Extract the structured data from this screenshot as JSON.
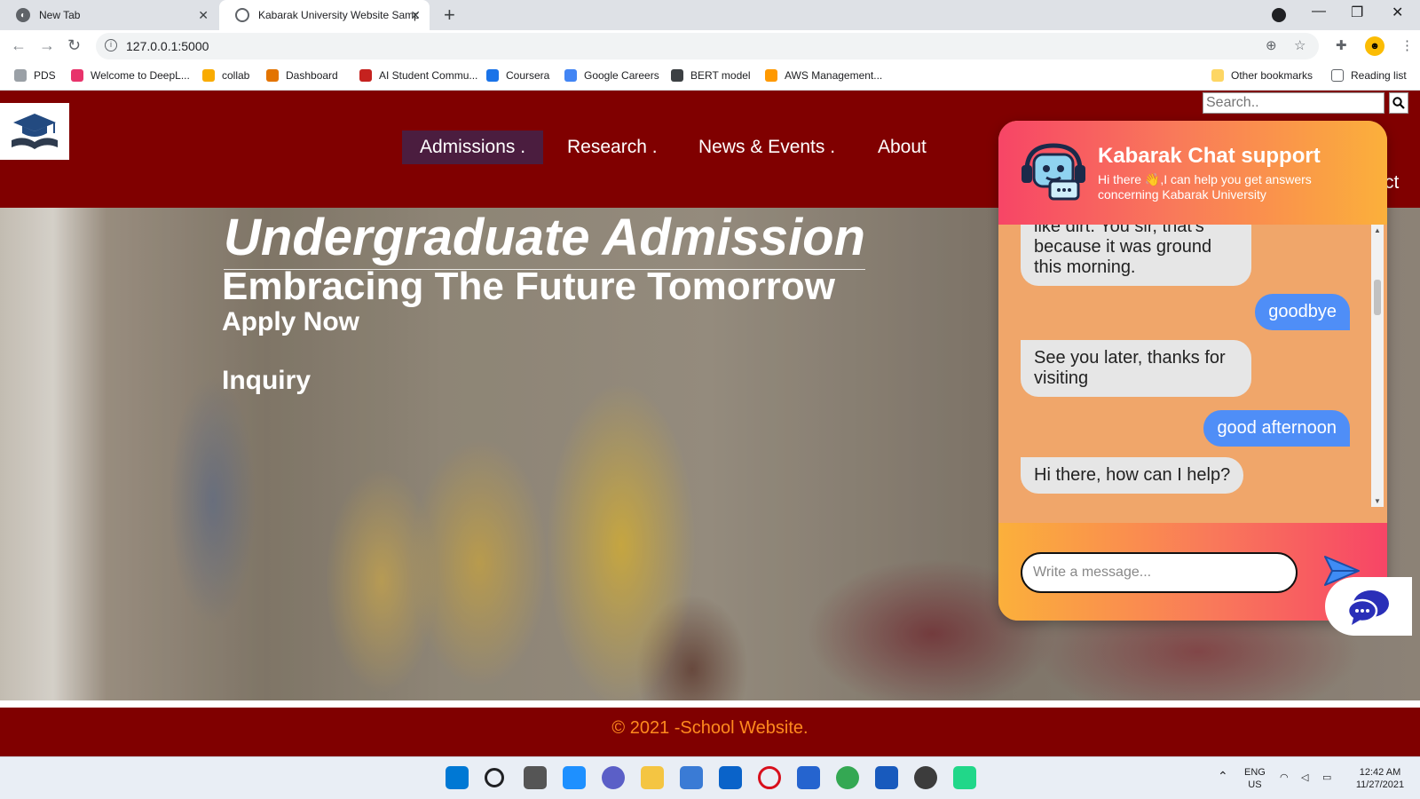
{
  "browser": {
    "tabs": [
      {
        "title": "New Tab",
        "active": false
      },
      {
        "title": "Kabarak University Website Samp",
        "active": true
      }
    ],
    "url": "127.0.0.1:5000",
    "bookmarks": [
      {
        "label": "PDS",
        "color": "#9aa0a6"
      },
      {
        "label": "Welcome to DeepL...",
        "color": "#e8336b"
      },
      {
        "label": "collab",
        "color": "#f9ab00"
      },
      {
        "label": "Dashboard",
        "color": "#e37400"
      },
      {
        "label": "AI Student Commu...",
        "color": "#c5221f"
      },
      {
        "label": "Coursera",
        "color": "#1a73e8"
      },
      {
        "label": "Google Careers",
        "color": "#4285f4"
      },
      {
        "label": "BERT model",
        "color": "#3c4043"
      },
      {
        "label": "AWS Management...",
        "color": "#ff9900"
      }
    ],
    "other_bookmarks": "Other bookmarks",
    "reading_list": "Reading list"
  },
  "site": {
    "search_placeholder": "Search..",
    "nav": [
      "Admissions .",
      "Research .",
      "News & Events .",
      "About"
    ],
    "nav_partial": "ct",
    "hero": {
      "title": "Undergraduate Admission",
      "subtitle": "Embracing The Future Tomorrow",
      "apply": "Apply Now",
      "inquiry": "Inquiry"
    },
    "footer": "© 2021 -School Website."
  },
  "chat": {
    "title": "Kabarak Chat support",
    "subtitle": "Hi there 👋,I can help you get answers concerning Kabarak University",
    "messages": [
      {
        "from": "bot",
        "text": "like dirt. You sir, that's because it was ground this morning."
      },
      {
        "from": "user",
        "text": "goodbye"
      },
      {
        "from": "bot",
        "text": "See you later, thanks for visiting"
      },
      {
        "from": "user",
        "text": "good afternoon"
      },
      {
        "from": "bot",
        "text": "Hi there, how can I help?"
      }
    ],
    "input_placeholder": "Write a message..."
  },
  "taskbar": {
    "lang_line1": "ENG",
    "lang_line2": "US",
    "time": "12:42 AM",
    "date": "11/27/2021"
  },
  "colors": {
    "header": "#800000",
    "nav_active": "#4b1d3f",
    "footer_text": "#ff8a1e",
    "chat_user_bubble": "#4f8ef7",
    "chat_bot_bubble": "#e6e6e6"
  }
}
